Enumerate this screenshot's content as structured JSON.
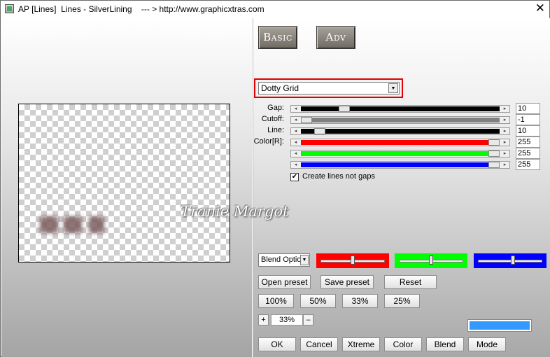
{
  "window": {
    "title": "AP [Lines]  Lines - SilverLining    --- > http://www.graphicxtras.com",
    "close_glyph": "✕"
  },
  "preview": {
    "watermark": "Tranie Margot"
  },
  "mode_buttons": {
    "basic": "Basic",
    "adv": "Adv"
  },
  "effect_select": {
    "value": "Dotty Grid"
  },
  "sliders": [
    {
      "label": "Gap:",
      "value": "10",
      "fill_color": "#000000",
      "position": 0.2
    },
    {
      "label": "Cutoff:",
      "value": "-1",
      "fill_color": "#808080",
      "position": 0.0
    },
    {
      "label": "Line:",
      "value": "10",
      "fill_color": "#000000",
      "position": 0.07
    },
    {
      "label": "Color[R]:",
      "value": "255",
      "fill_color": "#ff0000",
      "position": 1.0
    },
    {
      "label": "",
      "value": "255",
      "fill_color": "#00ff00",
      "position": 1.0
    },
    {
      "label": "",
      "value": "255",
      "fill_color": "#0000ff",
      "position": 1.0
    }
  ],
  "checkbox": {
    "label": "Create lines not gaps",
    "checked": true,
    "check_glyph": "✔"
  },
  "blend": {
    "value": "Blend Optio",
    "arrow_glyph": "▼"
  },
  "color_panels": [
    {
      "color": "#ff0000",
      "position": 0.5
    },
    {
      "color": "#00ff00",
      "position": 0.5
    },
    {
      "color": "#0000ff",
      "position": 0.55
    }
  ],
  "preset_buttons": {
    "open": "Open preset",
    "save": "Save preset",
    "reset": "Reset"
  },
  "zoom_buttons": [
    "100%",
    "50%",
    "33%",
    "25%"
  ],
  "zoom": {
    "plus": "+",
    "value": "33%",
    "minus": "–"
  },
  "swatch_color": "#3399ff",
  "bottom_buttons": {
    "ok": "OK",
    "cancel": "Cancel",
    "xtreme": "Xtreme",
    "color": "Color",
    "blend": "Blend",
    "mode": "Mode"
  }
}
